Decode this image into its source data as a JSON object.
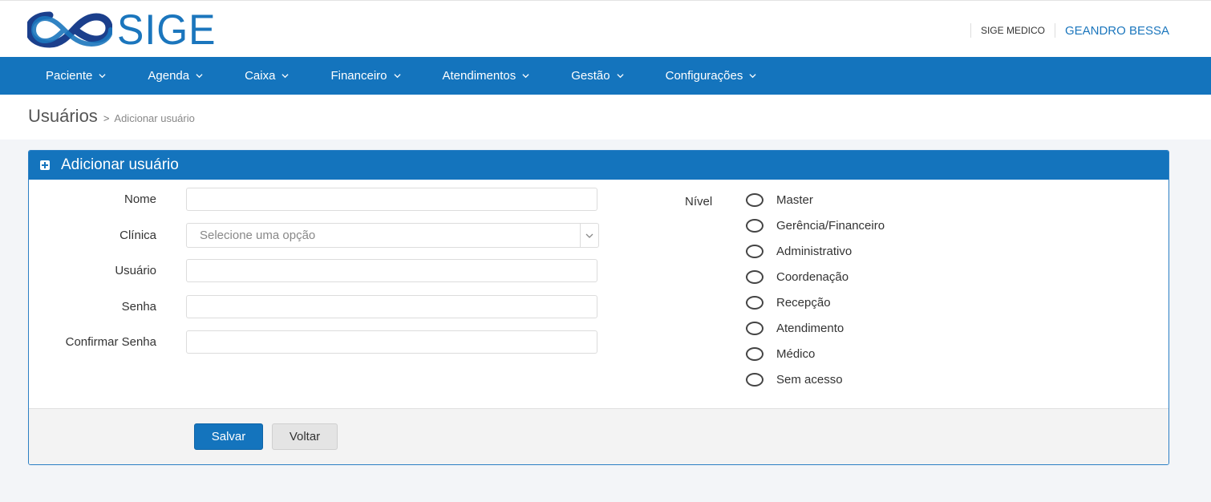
{
  "brand": {
    "name": "SIGE",
    "color": "#1474bd"
  },
  "header": {
    "clinic": "SIGE MEDICO",
    "user": "GEANDRO BESSA"
  },
  "nav": [
    {
      "label": "Paciente"
    },
    {
      "label": "Agenda"
    },
    {
      "label": "Caixa"
    },
    {
      "label": "Financeiro"
    },
    {
      "label": "Atendimentos"
    },
    {
      "label": "Gestão"
    },
    {
      "label": "Configurações"
    }
  ],
  "breadcrumb": {
    "main": "Usuários",
    "separator": ">",
    "current": "Adicionar usuário"
  },
  "panel": {
    "title": "Adicionar usuário",
    "fields": {
      "nome": {
        "label": "Nome",
        "value": ""
      },
      "clinica": {
        "label": "Clínica",
        "placeholder": "Selecione uma opção"
      },
      "usuario": {
        "label": "Usuário",
        "value": ""
      },
      "senha": {
        "label": "Senha",
        "value": ""
      },
      "confirmar": {
        "label": "Confirmar Senha",
        "value": ""
      }
    },
    "nivel": {
      "label": "Nível",
      "options": [
        "Master",
        "Gerência/Financeiro",
        "Administrativo",
        "Coordenação",
        "Recepção",
        "Atendimento",
        "Médico",
        "Sem acesso"
      ]
    },
    "buttons": {
      "save": "Salvar",
      "back": "Voltar"
    }
  }
}
